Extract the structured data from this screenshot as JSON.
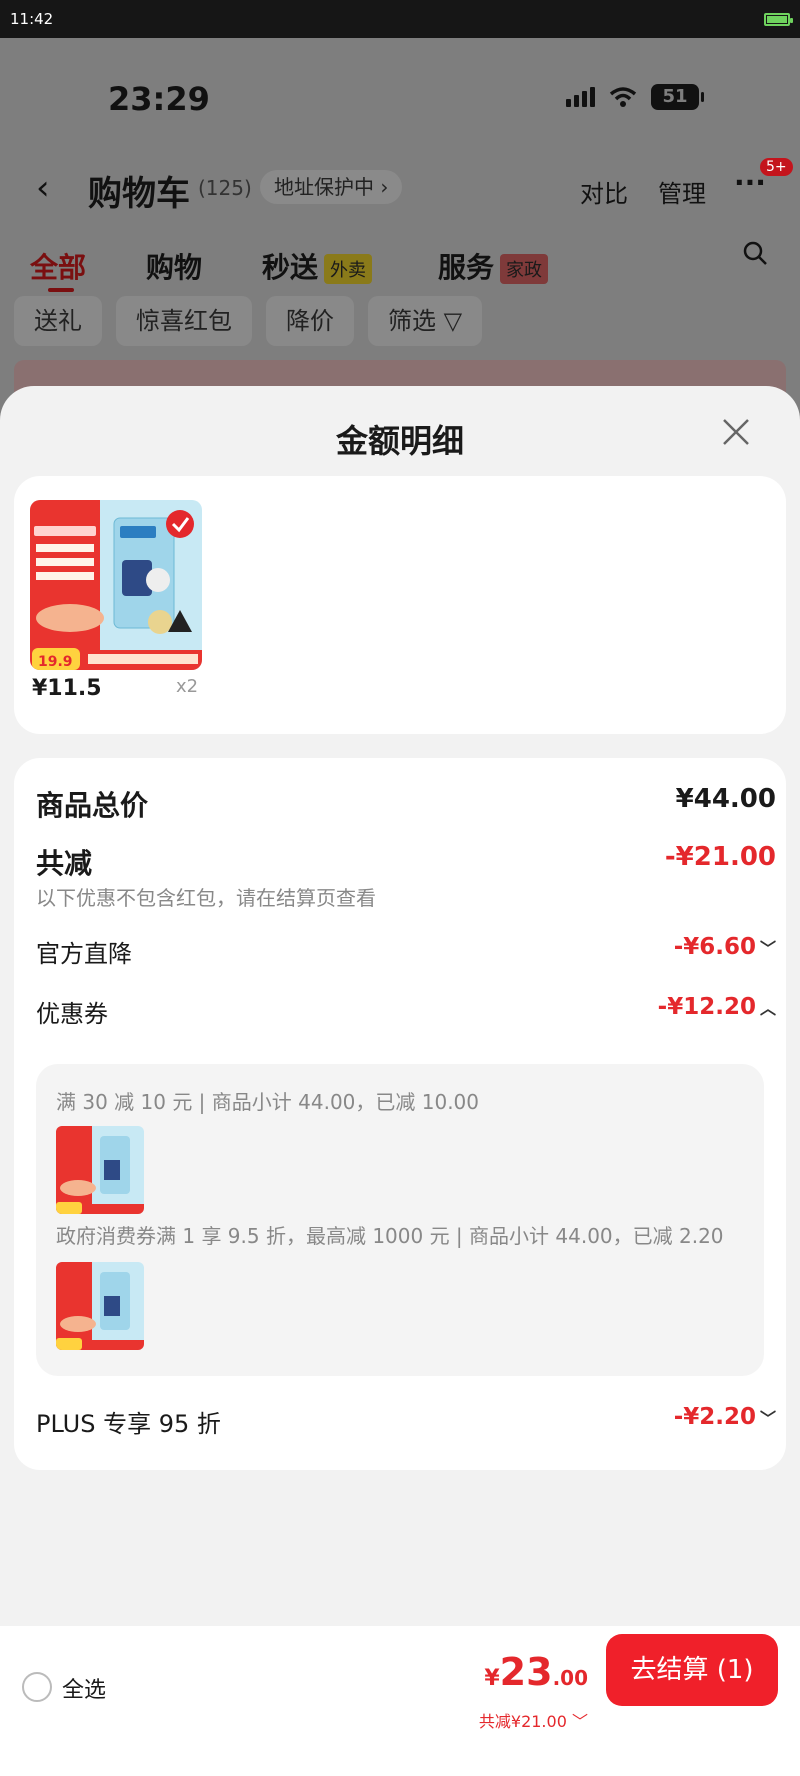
{
  "system_bar": {
    "time": "11:42"
  },
  "phone_status": {
    "time": "23:29",
    "battery": "51"
  },
  "cart_nav": {
    "title": "购物车",
    "count": "(125)",
    "address_pill": "地址保护中 ›",
    "compare": "对比",
    "manage": "管理",
    "more_badge": "5+"
  },
  "cart_tabs": [
    {
      "label": "全部"
    },
    {
      "label": "购物"
    },
    {
      "label": "秒送",
      "tag": "外卖"
    },
    {
      "label": "服务",
      "tag": "家政"
    }
  ],
  "filter_chips": [
    "送礼",
    "惊喜红包",
    "降价",
    "筛选"
  ],
  "sheet": {
    "title": "金额明细",
    "product": {
      "price": "¥11.5",
      "qty": "x2",
      "image_price": "19.9"
    },
    "summary": {
      "total_label": "商品总价",
      "total_value": "¥44.00",
      "discount_label": "共减",
      "discount_value": "-¥21.00",
      "discount_note": "以下优惠不包含红包，请在结算页查看",
      "official_label": "官方直降",
      "official_value": "-¥6.60",
      "coupon_label": "优惠券",
      "coupon_value": "-¥12.20",
      "coupon_line1": "满 30 减 10 元 | 商品小计 44.00，已减 10.00",
      "coupon_line2": "政府消费券满 1 享 9.5 折，最高减 1000 元 | 商品小计 44.00，已减 2.20",
      "plus_label": "PLUS 专享 95 折",
      "plus_value": "-¥2.20"
    }
  },
  "bottom_bar": {
    "select_all": "全选",
    "total_yen": "¥",
    "total_int": "23",
    "total_dec": ".00",
    "total_sub": "共减¥21.00",
    "checkout": "去结算 (1)"
  },
  "colors": {
    "accent": "#e4282c",
    "checkout_bg": "#f0202a"
  }
}
